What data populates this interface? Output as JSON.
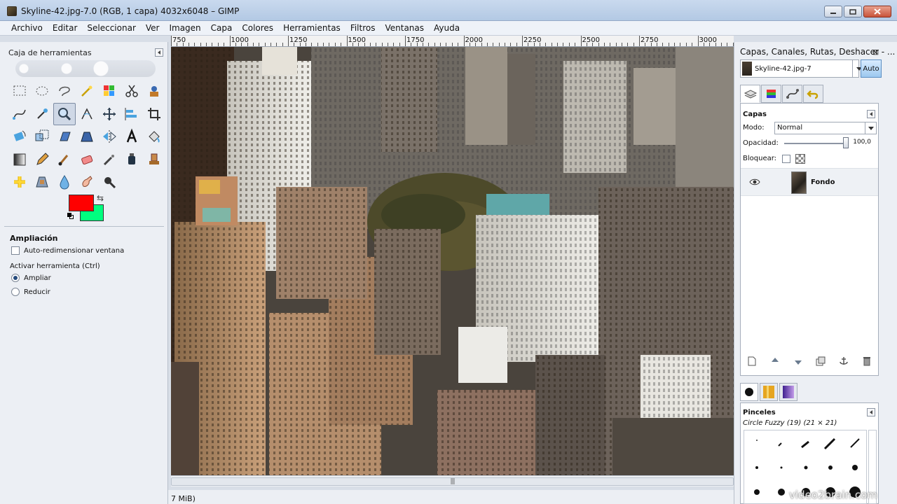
{
  "window": {
    "title": "Skyline-42.jpg-7.0 (RGB, 1 capa) 4032x6048 – GIMP"
  },
  "menu": [
    "Archivo",
    "Editar",
    "Seleccionar",
    "Ver",
    "Imagen",
    "Capa",
    "Colores",
    "Herramientas",
    "Filtros",
    "Ventanas",
    "Ayuda"
  ],
  "toolbox": {
    "title": "Caja de herramientas",
    "tools": [
      "rect-select-icon",
      "ellipse-select-icon",
      "lasso-icon",
      "fuzzy-select-icon",
      "by-color-select-icon",
      "scissors-select-icon",
      "foreground-select-icon",
      "paths-icon",
      "color-picker-icon",
      "zoom-icon",
      "measure-icon",
      "move-icon",
      "align-icon",
      "crop-icon",
      "rotate-icon",
      "scale-icon",
      "shear-icon",
      "perspective-icon",
      "flip-icon",
      "text-icon",
      "bucket-fill-icon",
      "blend-icon",
      "pencil-icon",
      "paintbrush-icon",
      "eraser-icon",
      "airbrush-icon",
      "ink-icon",
      "clone-icon",
      "heal-icon",
      "perspective-clone-icon",
      "blur-icon",
      "smudge-icon",
      "dodge-burn-icon"
    ],
    "active_tool": "zoom-icon",
    "fg_color": "#ff0000",
    "bg_color": "#00ff7f"
  },
  "tool_options": {
    "title": "Ampliación",
    "auto_resize_label": "Auto-redimensionar ventana",
    "activate_label": "Activar herramienta  (Ctrl)",
    "zoom_in_label": "Ampliar",
    "zoom_out_label": "Reducir",
    "selected": "Ampliar"
  },
  "ruler": {
    "labels": [
      "750",
      "1000",
      "1250",
      "1500",
      "1750",
      "2000",
      "2250",
      "2500",
      "2750",
      "3000"
    ]
  },
  "status": {
    "text": "7 MiB)"
  },
  "dock": {
    "title": "Capas, Canales, Rutas, Deshacer - ...",
    "image_name": "Skyline-42.jpg-7",
    "auto_label": "Auto",
    "layers": {
      "title": "Capas",
      "mode_label": "Modo:",
      "mode_value": "Normal",
      "opacity_label": "Opacidad:",
      "opacity_value": "100,0",
      "lock_label": "Bloquear:",
      "layer_name": "Fondo"
    },
    "brushes": {
      "title": "Pinceles",
      "selected": "Circle Fuzzy (19) (21 × 21)"
    }
  },
  "watermark": "video2brain.com"
}
